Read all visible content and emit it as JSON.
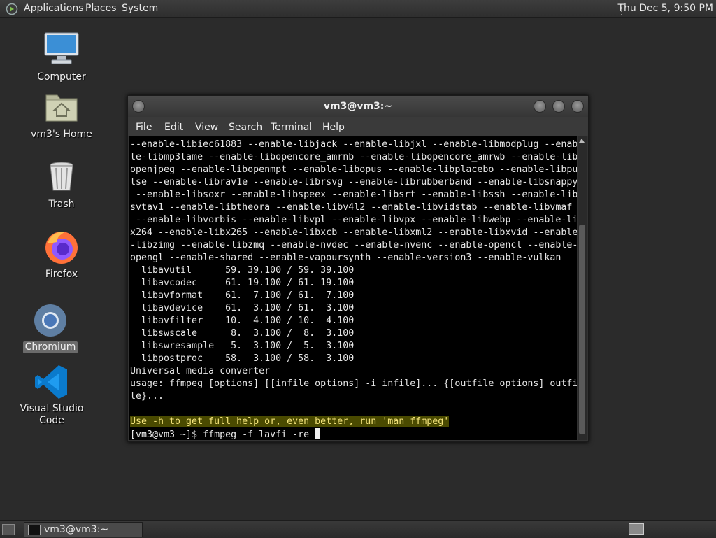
{
  "top_panel": {
    "menus": [
      "Applications",
      "Places",
      "System"
    ],
    "clock": "Thu Dec  5,  9:50 PM"
  },
  "desktop": {
    "icons": [
      {
        "label": "Computer",
        "icon": "computer-icon"
      },
      {
        "label": "vm3's Home",
        "icon": "home-folder-icon"
      },
      {
        "label": "Trash",
        "icon": "trash-icon"
      },
      {
        "label": "Firefox",
        "icon": "firefox-icon"
      },
      {
        "label": "Chromium",
        "icon": "chromium-icon",
        "selected": true
      },
      {
        "label": "Visual Studio Code",
        "icon": "vscode-icon"
      }
    ]
  },
  "terminal": {
    "title": "vm3@vm3:~",
    "menu": [
      "File",
      "Edit",
      "View",
      "Search",
      "Terminal",
      "Help"
    ],
    "lines": [
      "--enable-libiec61883 --enable-libjack --enable-libjxl --enable-libmodplug --enab",
      "le-libmp3lame --enable-libopencore_amrnb --enable-libopencore_amrwb --enable-lib",
      "openjpeg --enable-libopenmpt --enable-libopus --enable-libplacebo --enable-libpu",
      "lse --enable-librav1e --enable-librsvg --enable-librubberband --enable-libsnappy",
      " --enable-libsoxr --enable-libspeex --enable-libsrt --enable-libssh --enable-lib",
      "svtav1 --enable-libtheora --enable-libv4l2 --enable-libvidstab --enable-libvmaf",
      " --enable-libvorbis --enable-libvpl --enable-libvpx --enable-libwebp --enable-lib",
      "x264 --enable-libx265 --enable-libxcb --enable-libxml2 --enable-libxvid --enable",
      "-libzimg --enable-libzmq --enable-nvdec --enable-nvenc --enable-opencl --enable-",
      "opengl --enable-shared --enable-vapoursynth --enable-version3 --enable-vulkan",
      "  libavutil      59. 39.100 / 59. 39.100",
      "  libavcodec     61. 19.100 / 61. 19.100",
      "  libavformat    61.  7.100 / 61.  7.100",
      "  libavdevice    61.  3.100 / 61.  3.100",
      "  libavfilter    10.  4.100 / 10.  4.100",
      "  libswscale      8.  3.100 /  8.  3.100",
      "  libswresample   5.  3.100 /  5.  3.100",
      "  libpostproc    58.  3.100 / 58.  3.100",
      "Universal media converter",
      "usage: ffmpeg [options] [[infile options] -i infile]... {[outfile options] outfi",
      "le}...",
      ""
    ],
    "hint_line": "Use -h to get full help or, even better, run 'man ffmpeg'",
    "prompt": "[vm3@vm3 ~]$ ",
    "command": "ffmpeg -f lavfi -re "
  },
  "bottom_panel": {
    "task_label": "vm3@vm3:~"
  }
}
